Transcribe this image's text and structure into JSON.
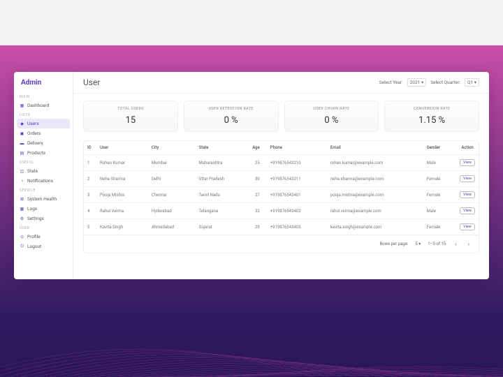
{
  "brand": "Admin",
  "sidebar": {
    "sections": [
      {
        "label": "MAIN",
        "items": [
          {
            "icon": "▦",
            "label": "Dashboard"
          }
        ]
      },
      {
        "label": "LISTS",
        "items": [
          {
            "icon": "◆",
            "label": "Users",
            "active": true
          },
          {
            "icon": "▣",
            "label": "Orders"
          },
          {
            "icon": "▬",
            "label": "Delivery"
          },
          {
            "icon": "▤",
            "label": "Products"
          }
        ]
      },
      {
        "label": "USEFUL",
        "items": [
          {
            "icon": "◫",
            "label": "Stats"
          },
          {
            "icon": "◔",
            "label": "Notifications"
          }
        ]
      },
      {
        "label": "SERVICE",
        "items": [
          {
            "icon": "⊞",
            "label": "System Health"
          },
          {
            "icon": "▦",
            "label": "Logs"
          },
          {
            "icon": "⚙",
            "label": "Settings"
          }
        ]
      },
      {
        "label": "USER",
        "items": [
          {
            "icon": "⊙",
            "label": "Profile"
          },
          {
            "icon": "⏻",
            "label": "Logout"
          }
        ]
      }
    ]
  },
  "page": {
    "title": "User"
  },
  "filters": {
    "year_label": "Select Year:",
    "year_value": "2021 ▾",
    "quarter_label": "Select Quarter:",
    "quarter_value": "Q1 ▾"
  },
  "cards": [
    {
      "label": "TOTAL USERS",
      "value": "15"
    },
    {
      "label": "USER RETENTION RATE",
      "value": "0 %"
    },
    {
      "label": "USER CHURN RATE",
      "value": "0 %"
    },
    {
      "label": "CONVERSION RATE",
      "value": "1.15 %"
    }
  ],
  "table": {
    "headers": [
      "ID",
      "User",
      "City",
      "State",
      "Age",
      "Phone",
      "Email",
      "Gender",
      "Action"
    ],
    "rows": [
      {
        "id": "1",
        "user": "Rohan Kumar",
        "city": "Mumbai",
        "state": "Maharashtra",
        "age": "25",
        "phone": "+919876543210",
        "email": "rohan.kumar@example.com",
        "gender": "Male"
      },
      {
        "id": "2",
        "user": "Neha Sharma",
        "city": "Delhi",
        "state": "Uttar Pradesh",
        "age": "30",
        "phone": "+919876543211",
        "email": "neha.sharma@example.com",
        "gender": "Female"
      },
      {
        "id": "3",
        "user": "Pooja Mishra",
        "city": "Chennai",
        "state": "Tamil Nadu",
        "age": "27",
        "phone": "+919876543401",
        "email": "pooja.mishra@example.com",
        "gender": "Female"
      },
      {
        "id": "4",
        "user": "Rahul Verma",
        "city": "Hyderabad",
        "state": "Telangana",
        "age": "32",
        "phone": "+919876543402",
        "email": "rahul.verma@example.com",
        "gender": "Male"
      },
      {
        "id": "5",
        "user": "Kavita Singh",
        "city": "Ahmedabad",
        "state": "Gujarat",
        "age": "29",
        "phone": "+919876543403",
        "email": "kavita.singh@example.com",
        "gender": "Female"
      }
    ],
    "action_label": "View"
  },
  "pagination": {
    "rows_label": "Rows per page:",
    "rows_value": "5 ▾",
    "range": "1–5 of 15"
  }
}
